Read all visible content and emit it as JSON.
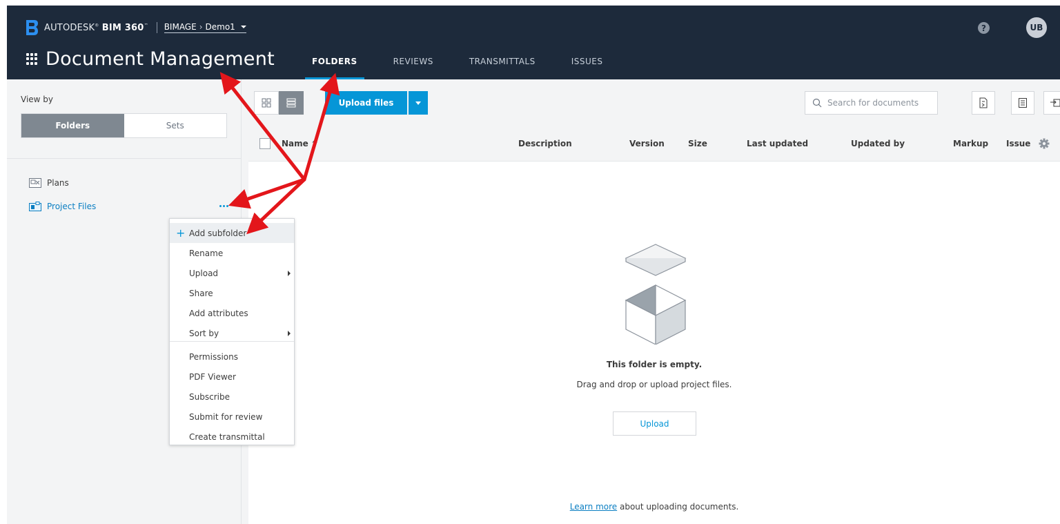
{
  "header": {
    "brand_prefix": "AUTODESK",
    "brand_product": "BIM 360",
    "breadcrumb_account": "BIMAGE",
    "breadcrumb_arrow": "›",
    "breadcrumb_project": "Demo1",
    "help_label": "?",
    "avatar_initials": "UB",
    "app_title": "Document Management",
    "tabs": [
      {
        "label": "FOLDERS",
        "active": true
      },
      {
        "label": "REVIEWS",
        "active": false
      },
      {
        "label": "TRANSMITTALS",
        "active": false
      },
      {
        "label": "ISSUES",
        "active": false
      }
    ]
  },
  "sidebar": {
    "view_by_label": "View by",
    "segments": [
      {
        "label": "Folders",
        "active": true
      },
      {
        "label": "Sets",
        "active": false
      }
    ],
    "tree": [
      {
        "label": "Plans"
      },
      {
        "label": "Project Files",
        "selected": true
      }
    ]
  },
  "context_menu": {
    "items": [
      {
        "label": "Add subfolder",
        "icon": "plus-icon",
        "highlighted": true
      },
      {
        "label": "Rename"
      },
      {
        "label": "Upload",
        "submenu": true
      },
      {
        "label": "Share"
      },
      {
        "label": "Add attributes"
      },
      {
        "label": "Sort by",
        "submenu": true
      },
      {
        "label": "Permissions"
      },
      {
        "label": "PDF Viewer"
      },
      {
        "label": "Subscribe"
      },
      {
        "label": "Submit for review"
      },
      {
        "label": "Create transmittal"
      }
    ]
  },
  "toolbar": {
    "upload_label": "Upload files",
    "search_placeholder": "Search for documents"
  },
  "table": {
    "columns": [
      "Name",
      "Description",
      "Version",
      "Size",
      "Last updated",
      "Updated by",
      "Markup",
      "Issue"
    ]
  },
  "empty_state": {
    "title": "This folder is empty.",
    "subtitle": "Drag and drop or upload project files.",
    "upload_button": "Upload",
    "learn_link": "Learn more",
    "learn_rest": " about uploading documents."
  },
  "colors": {
    "header_bg": "#1d2a3b",
    "accent": "#0696d7",
    "annotation_arrow": "#e3161b"
  }
}
